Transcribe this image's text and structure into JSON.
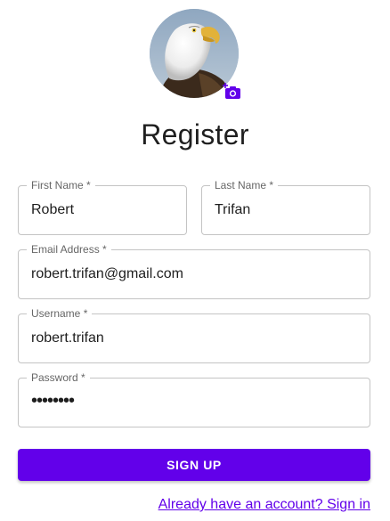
{
  "profile": {
    "avatar_icon": "eagle-avatar-image",
    "camera_icon": "add-photo-icon",
    "accent_color": "#6200ea"
  },
  "title": "Register",
  "form": {
    "first_name": {
      "label": "First Name *",
      "value": "Robert"
    },
    "last_name": {
      "label": "Last Name *",
      "value": "Trifan"
    },
    "email": {
      "label": "Email Address *",
      "value": "robert.trifan@gmail.com"
    },
    "username": {
      "label": "Username *",
      "value": "robert.trifan"
    },
    "password": {
      "label": "Password *",
      "value": "••••••••"
    }
  },
  "submit_label": "SIGN UP",
  "signin_link": "Already have an account? Sign in"
}
